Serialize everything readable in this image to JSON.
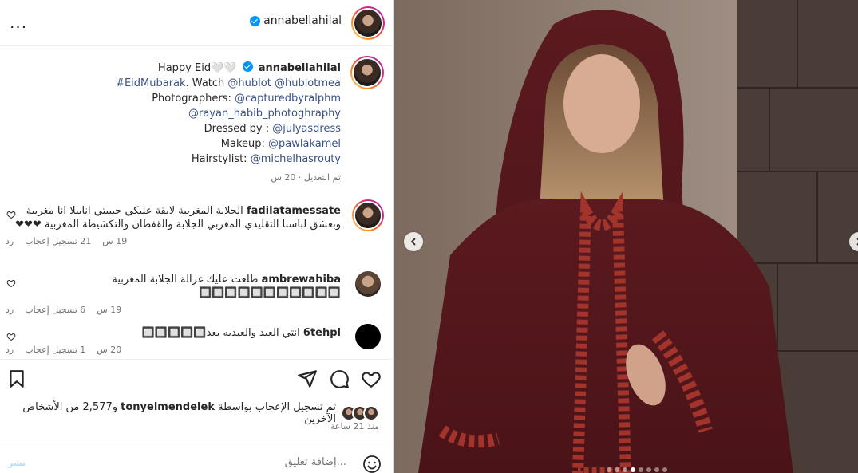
{
  "header": {
    "username": "annabellahilal",
    "verified": true,
    "more_label": "..."
  },
  "caption": {
    "greeting": "Happy Eid🤍🤍",
    "username": "annabellahilal",
    "hashtag": "#EidMubarak",
    "watch_text": ". Watch ",
    "watch_link_1": "@hublot",
    "watch_link_2": "@hublotmea",
    "photographers_label": "Photographers: ",
    "photographer_1": "@capturedbyralphm",
    "photographer_2": "@rayan_habib_photoghraphy",
    "dressed_label": "Dressed by : ",
    "dressed_by": "@julyasdress",
    "makeup_label": "Makeup: ",
    "makeup": "@pawlakamel",
    "hair_label": "Hairstylist: ",
    "hair": "@michelhasrouty",
    "edited": "تم التعديل · 20 س"
  },
  "comments": [
    {
      "username": "fadilatamessate",
      "text": "الجلابة المغربية لايقة عليكي حبيبتي انابيلا انا مغربية وبعشق لباسنا التقليدي المغربي الجلابة والقفطان والتكشيطة المغربية ❤❤❤",
      "time": "19 س",
      "likes": "21 تسجيل إعجاب",
      "reply": "رد"
    },
    {
      "username": "ambrewahiba",
      "text": "طلعت عليك غزالة الجلابة المغربية 🔲🔲🔲🔲🔲🔲🔲🔲🔲🔲🔲",
      "time": "19 س",
      "likes": "6 تسجيل إعجاب",
      "reply": "رد"
    },
    {
      "username": "6tehpl",
      "text": "انتي العيد والعيديه بعد🔲🔲🔲🔲🔲",
      "time": "20 س",
      "likes": "1 تسجيل إعجاب",
      "reply": "رد"
    }
  ],
  "likes": {
    "prefix": "تم تسجيل الإعجاب بواسطة ",
    "user": "tonyelmendelek",
    "suffix": " و2,577 من الأشخاص الآخرين",
    "posted": "منذ 21 ساعة"
  },
  "add_comment": {
    "placeholder": "إضافة تعليق...",
    "post_label": "نشر"
  },
  "carousel": {
    "total": 8,
    "active_index": 3
  },
  "icons": {
    "heart": "heart-icon",
    "comment": "comment-icon",
    "share": "share-icon",
    "save": "bookmark-icon",
    "emoji": "emoji-icon",
    "more": "more-icon"
  }
}
